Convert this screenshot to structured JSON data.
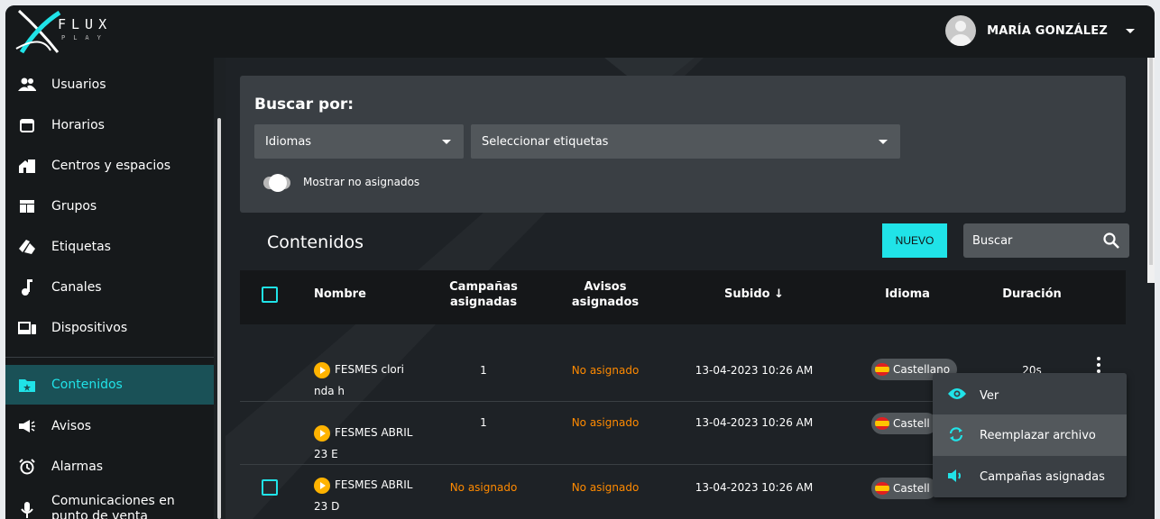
{
  "app": {
    "brand": "FLUX",
    "brand_sub": "PLAY"
  },
  "user": {
    "name": "MARÍA GONZÁLEZ"
  },
  "sidebar": {
    "items": [
      {
        "label": "Usuarios",
        "icon": "users-icon"
      },
      {
        "label": "Horarios",
        "icon": "calendar-icon"
      },
      {
        "label": "Centros y espacios",
        "icon": "building-icon"
      },
      {
        "label": "Grupos",
        "icon": "grid-icon"
      },
      {
        "label": "Etiquetas",
        "icon": "tags-icon"
      },
      {
        "label": "Canales",
        "icon": "music-note-icon"
      },
      {
        "label": "Dispositivos",
        "icon": "devices-icon"
      },
      {
        "label": "Contenidos",
        "icon": "folder-star-icon",
        "active": true
      },
      {
        "label": "Avisos",
        "icon": "megaphone-icon"
      },
      {
        "label": "Alarmas",
        "icon": "alarm-clock-icon"
      },
      {
        "label": "Comunicaciones en punto de venta",
        "icon": "microphone-icon"
      }
    ]
  },
  "filter": {
    "title": "Buscar por:",
    "languages_select": "Idiomas",
    "tags_select": "Seleccionar etiquetas",
    "toggle_label": "Mostrar no asignados"
  },
  "content": {
    "title": "Contenidos",
    "new_button": "NUEVO",
    "search_placeholder": "Buscar"
  },
  "table": {
    "headers": {
      "name": "Nombre",
      "campaigns": "Campañas asignadas",
      "notices": "Avisos asignados",
      "uploaded": "Subido ↓",
      "language": "Idioma",
      "duration": "Duración"
    },
    "rows": [
      {
        "name1": "FESMES clori",
        "name2": "nda h",
        "campaigns": "1",
        "notices": "No asignado",
        "uploaded": "13-04-2023 10:26 AM",
        "language": "Castellano",
        "duration": "20s"
      },
      {
        "name1": "FESMES ABRIL",
        "name2": "23 E",
        "campaigns": "1",
        "notices": "No asignado",
        "uploaded": "13-04-2023 10:26 AM",
        "language": "Castell",
        "duration": ""
      },
      {
        "name1": "FESMES ABRIL",
        "name2": "23 D",
        "campaigns": "No asignado",
        "notices": "No asignado",
        "uploaded": "13-04-2023 10:26 AM",
        "language": "Castell",
        "duration": ""
      }
    ]
  },
  "context_menu": {
    "items": [
      {
        "label": "Ver",
        "icon": "eye-icon"
      },
      {
        "label": "Reemplazar archivo",
        "icon": "refresh-icon"
      },
      {
        "label": "Campañas asignadas",
        "icon": "speaker-icon"
      }
    ]
  },
  "colors": {
    "accent": "#20e3e8",
    "warning": "#ff8a00",
    "background": "#1d2124"
  }
}
